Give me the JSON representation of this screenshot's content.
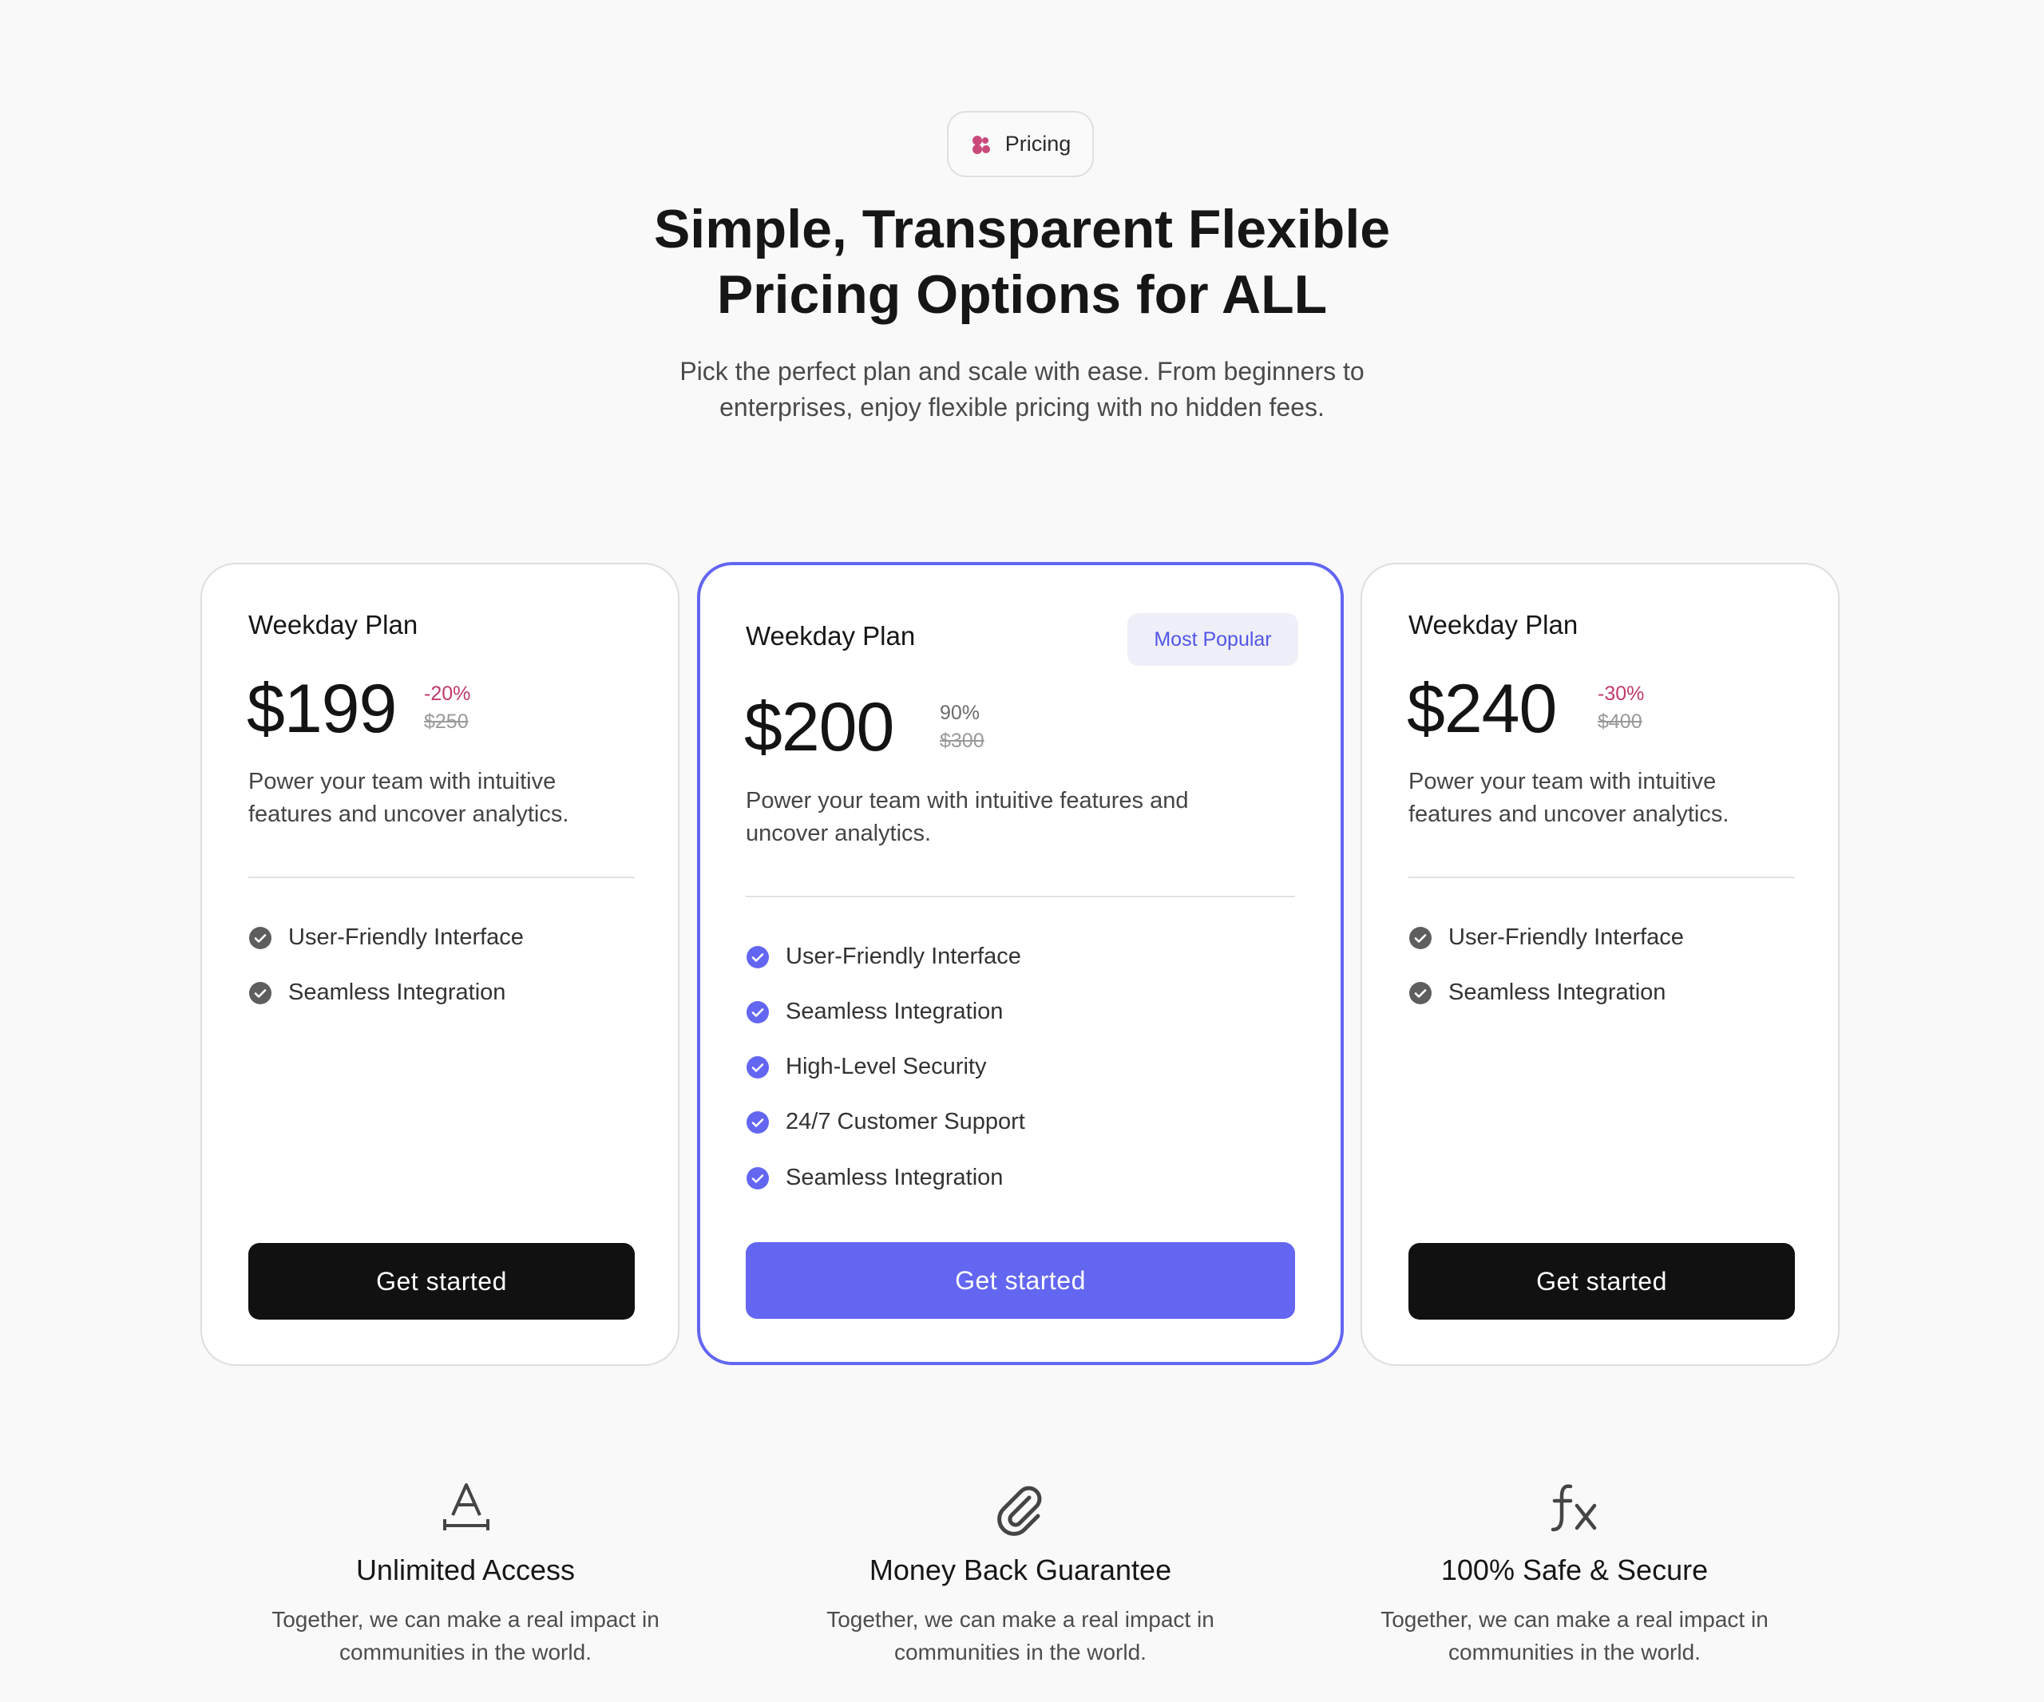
{
  "header": {
    "badge_label": "Pricing",
    "title_line1": "Simple, Transparent Flexible",
    "title_line2": "Pricing Options for ALL",
    "subtitle_line1": "Pick the perfect plan and scale with ease. From beginners to",
    "subtitle_line2": "enterprises, enjoy flexible pricing with no hidden fees."
  },
  "plans": [
    {
      "name": "Weekday Plan",
      "price": "$199",
      "discount": "-20%",
      "old_price": "$250",
      "desc_line1": "Power your team with intuitive",
      "desc_line2": "features and uncover analytics.",
      "features": [
        "User-Friendly Interface",
        "Seamless Integration"
      ],
      "cta": "Get started"
    },
    {
      "name": "Weekday Plan",
      "badge": "Most Popular",
      "price": "$200",
      "discount": "90%",
      "old_price": "$300",
      "desc_line1": "Power your team with intuitive features and",
      "desc_line2": "uncover analytics.",
      "features": [
        "User-Friendly Interface",
        "Seamless Integration",
        "High-Level Security",
        "24/7 Customer Support",
        "Seamless Integration"
      ],
      "cta": "Get started"
    },
    {
      "name": "Weekday Plan",
      "price": "$240",
      "discount": "-30%",
      "old_price": "$400",
      "desc_line1": "Power your team with intuitive",
      "desc_line2": "features and uncover analytics.",
      "features": [
        "User-Friendly Interface",
        "Seamless Integration"
      ],
      "cta": "Get started"
    }
  ],
  "benefits": [
    {
      "icon": "text-format-icon",
      "title": "Unlimited Access",
      "line1": "Together, we can make a real impact in",
      "line2": "communities in the world."
    },
    {
      "icon": "paperclip-icon",
      "title": "Money Back Guarantee",
      "line1": "Together, we can make a real impact in",
      "line2": "communities in the world."
    },
    {
      "icon": "function-fx-icon",
      "title": "100% Safe & Secure",
      "line1": "Together, we can make a real impact in",
      "line2": "communities in the world."
    }
  ],
  "colors": {
    "accent": "#6366f1",
    "discount": "#c23a6e",
    "dark_button": "#111111",
    "background": "#f9f9f9"
  }
}
